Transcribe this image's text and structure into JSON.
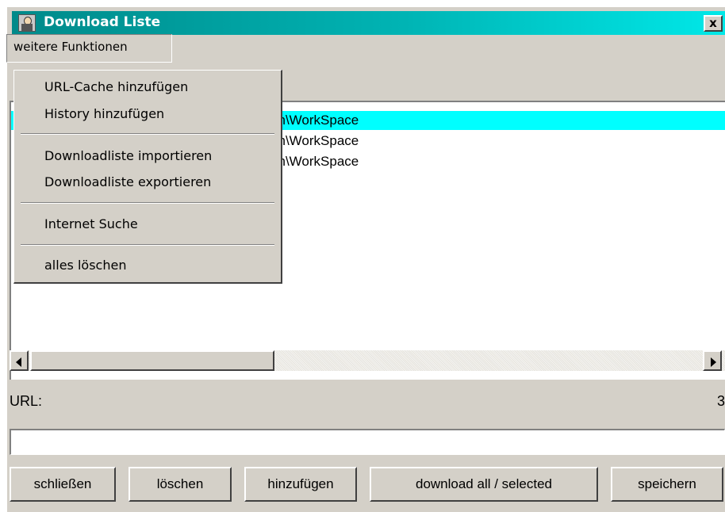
{
  "window": {
    "title": "Download Liste",
    "close_label": "x"
  },
  "menubar": {
    "menu_label": "weitere Funktionen"
  },
  "popup_menu": {
    "items": [
      {
        "label": "URL-Cache hinzufügen"
      },
      {
        "label": "History hinzufügen"
      },
      {
        "label": "Downloadliste importieren"
      },
      {
        "label": "Downloadliste exportieren"
      },
      {
        "label": "Internet Suche"
      },
      {
        "label": "alles löschen"
      }
    ]
  },
  "download_list": {
    "rows": [
      {
        "text": "n\\Administrator.PENTIUM300\\Eigene Dateien\\WorkSpace",
        "selected": true
      },
      {
        "text": "n\\Administrator.PENTIUM300\\Eigene Dateien\\WorkSpace",
        "selected": false
      },
      {
        "text": "n\\Administrator.PENTIUM300\\Eigene Dateien\\WorkSpace",
        "selected": false
      }
    ]
  },
  "url_section": {
    "label": "URL:",
    "count": "3",
    "input_value": ""
  },
  "buttons": {
    "close": "schließen",
    "delete": "löschen",
    "add": "hinzufügen",
    "download": "download all / selected",
    "save": "speichern"
  },
  "colors": {
    "title_gradient_start": "#008a8a",
    "title_gradient_end": "#00e8e8",
    "selection": "#00ffff",
    "window_bg": "#d4d0c8"
  }
}
